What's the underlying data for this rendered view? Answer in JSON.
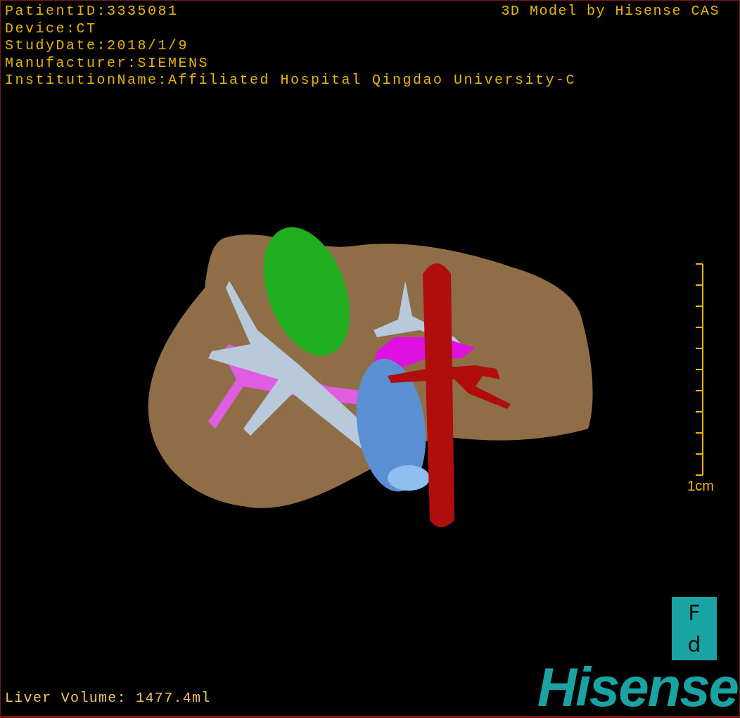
{
  "info_lines": [
    "PatientID:3335081",
    "Device:CT",
    "StudyDate:2018/1/9",
    "Manufacturer:SIEMENS",
    "InstitutionName:Affiliated Hospital Qingdao University-C"
  ],
  "title": "3D Model by Hisense CAS",
  "scale_bar": {
    "label": "1cm"
  },
  "orientation_cube": {
    "top": "F",
    "bottom": "d"
  },
  "liver_volume": "Liver Volume: 1477.4ml",
  "logo": "Hisense"
}
